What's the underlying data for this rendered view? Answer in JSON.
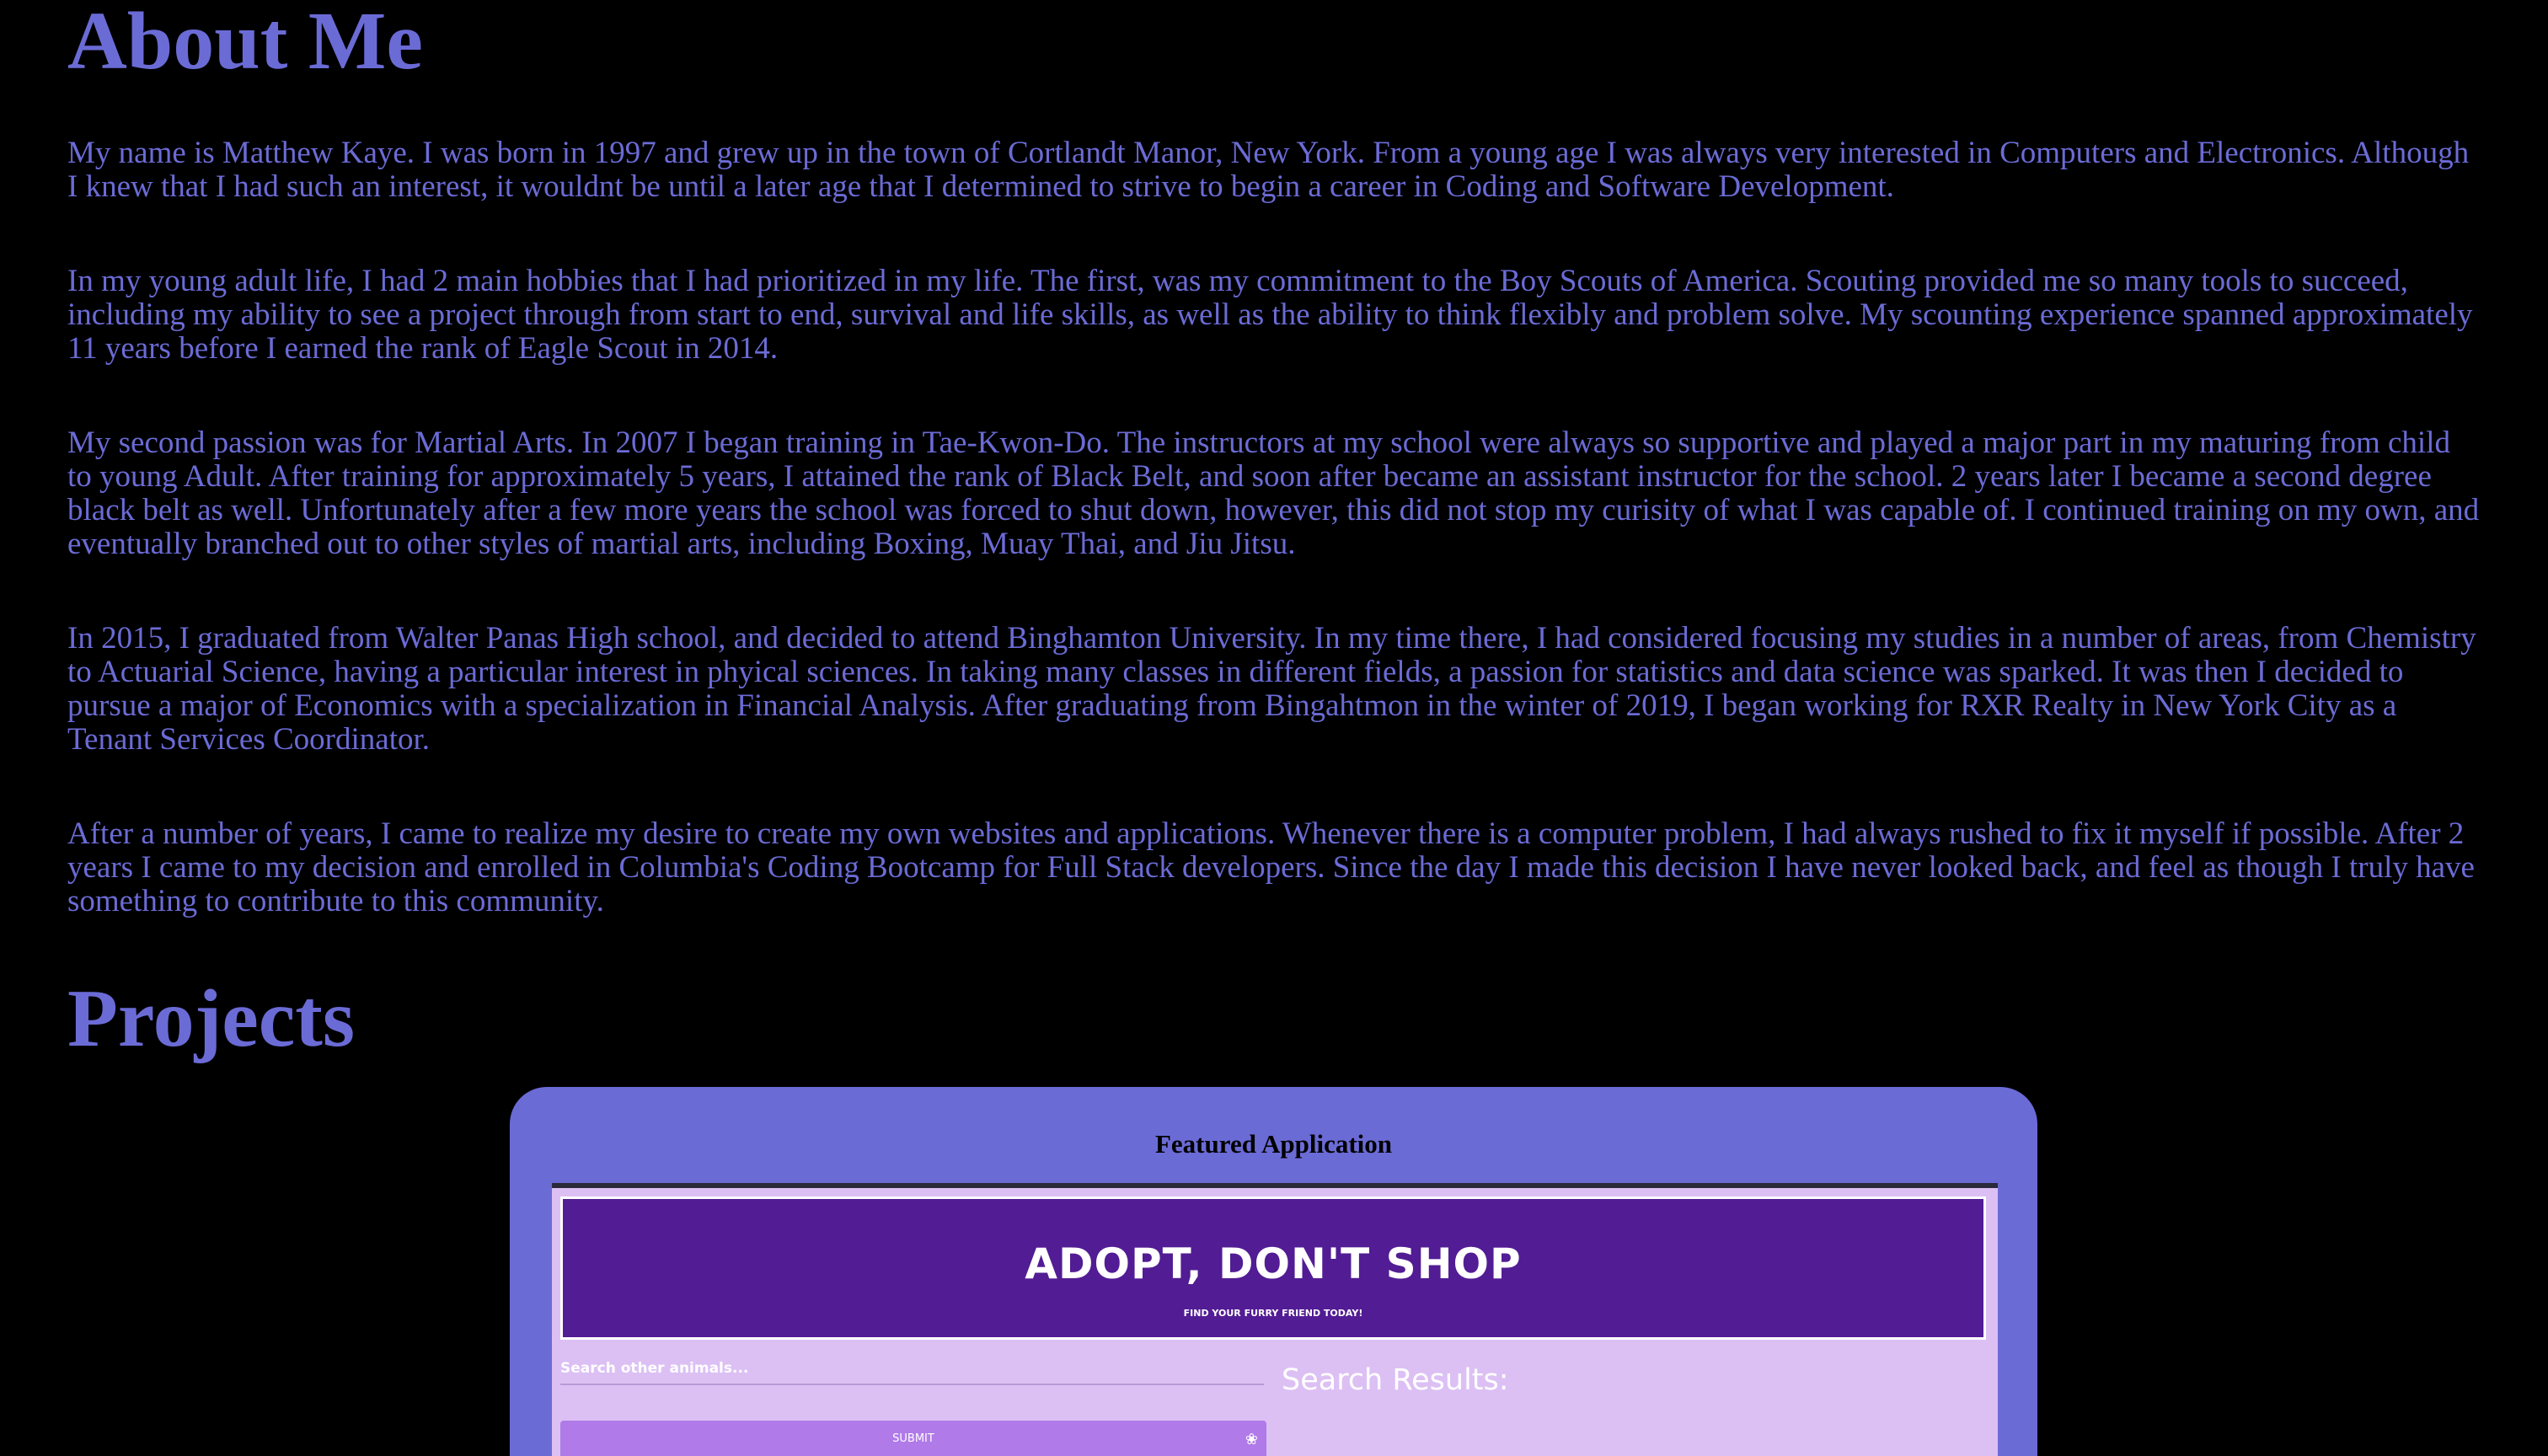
{
  "about": {
    "title": "About Me",
    "paragraphs": [
      "My name is Matthew Kaye. I was born in 1997 and grew up in the town of Cortlandt Manor, New York. From a young age I was always very interested in Computers and Electronics. Although I knew that I had such an interest, it wouldnt be until a later age that I determined to strive to begin a career in Coding and Software Development.",
      "In my young adult life, I had 2 main hobbies that I had prioritized in my life. The first, was my commitment to the Boy Scouts of America. Scouting provided me so many tools to succeed, including my ability to see a project through from start to end, survival and life skills, as well as the ability to think flexibly and problem solve. My scounting experience spanned approximately 11 years before I earned the rank of Eagle Scout in 2014.",
      "My second passion was for Martial Arts. In 2007 I began training in Tae-Kwon-Do. The instructors at my school were always so supportive and played a major part in my maturing from child to young Adult. After training for approximately 5 years, I attained the rank of Black Belt, and soon after became an assistant instructor for the school. 2 years later I became a second degree black belt as well. Unfortunately after a few more years the school was forced to shut down, however, this did not stop my curisity of what I was capable of. I continued training on my own, and eventually branched out to other styles of martial arts, including Boxing, Muay Thai, and Jiu Jitsu.",
      "In 2015, I graduated from Walter Panas High school, and decided to attend Binghamton University. In my time there, I had considered focusing my studies in a number of areas, from Chemistry to Actuarial Science, having a particular interest in phyical sciences. In taking many classes in different fields, a passion for statistics and data science was sparked. It was then I decided to pursue a major of Economics with a specialization in Financial Analysis. After graduating from Bingahtmon in the winter of 2019, I began working for RXR Realty in New York City as a Tenant Services Coordinator.",
      "After a number of years, I came to realize my desire to create my own websites and applications. Whenever there is a computer problem, I had always rushed to fix it myself if possible. After 2 years I came to my decision and enrolled in Columbia's Coding Bootcamp for Full Stack developers. Since the day I made this decision I have never looked back, and feel as though I truly have something to contribute to this community."
    ]
  },
  "projects": {
    "title": "Projects",
    "featured": {
      "label": "Featured Application",
      "app_title": "ADOPT, DON'T SHOP",
      "app_subtitle": "FIND YOUR FURRY FRIEND TODAY!",
      "search_placeholder": "Search other animals...",
      "submit_label": "SUBMIT",
      "submit_icon": "paw-icon",
      "results_title": "Search Results:"
    }
  },
  "colors": {
    "background": "#000000",
    "accent": "#6b6bd6",
    "app_header": "#521c94",
    "app_body": "#dcc0f4",
    "submit_button": "#b07ae8"
  }
}
